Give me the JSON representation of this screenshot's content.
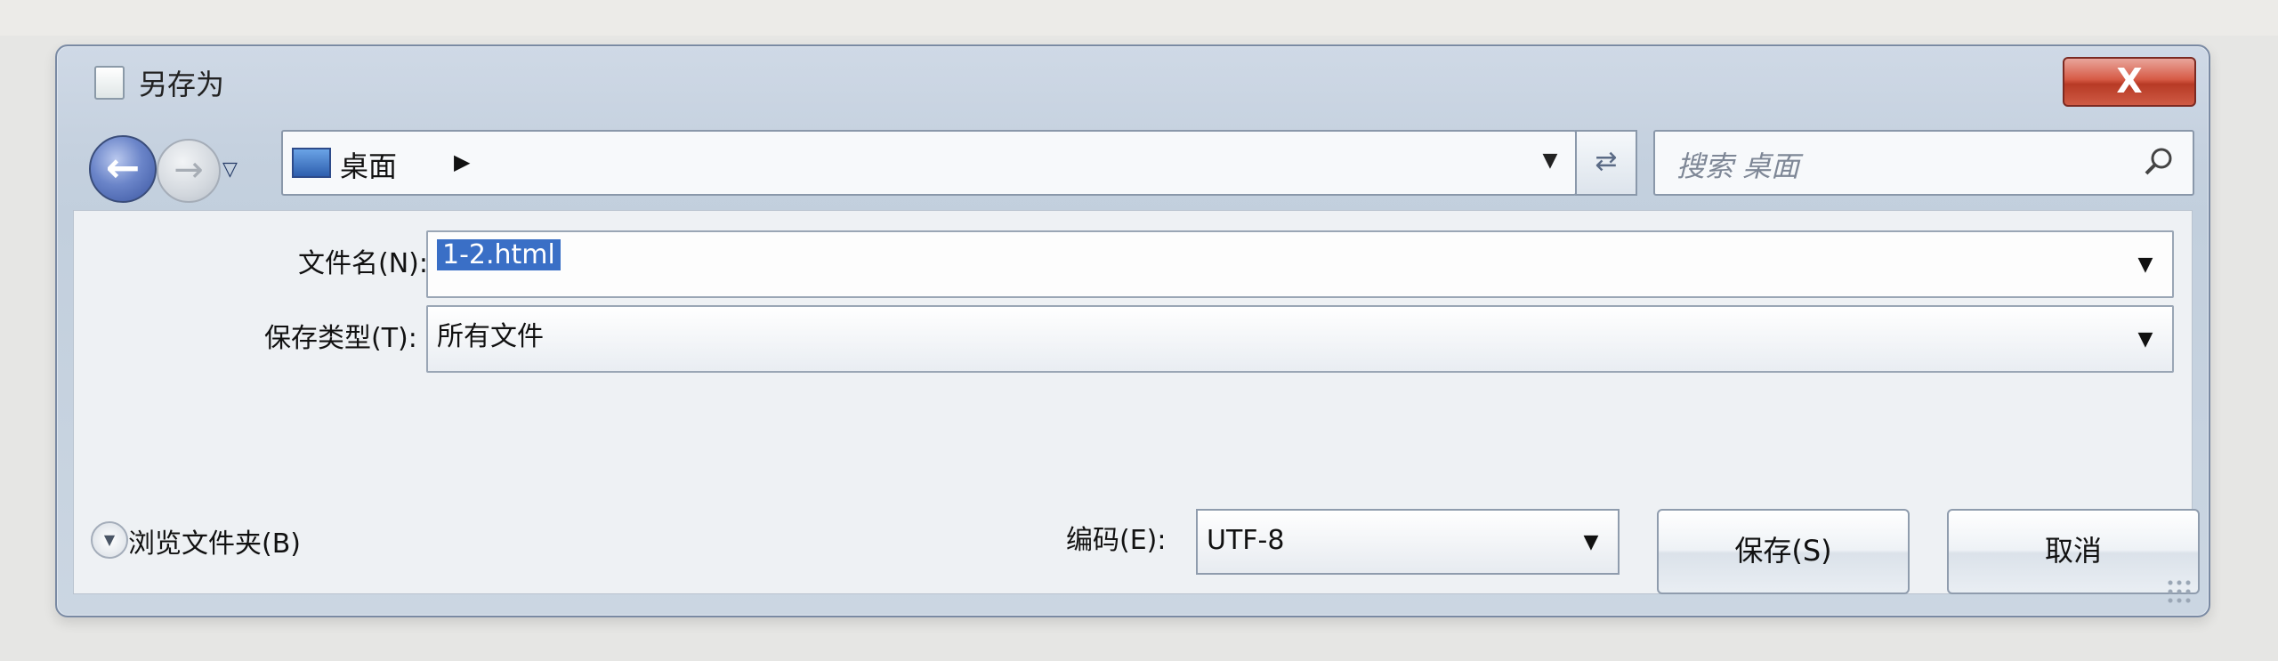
{
  "dialog": {
    "title": "另存为",
    "close_label": "X"
  },
  "nav": {
    "location": "桌面",
    "search_placeholder": "搜索 桌面"
  },
  "form": {
    "filename_label": "文件名(N):",
    "filename_value": "1-2.html",
    "filetype_label": "保存类型(T):",
    "filetype_value": "所有文件",
    "encoding_label": "编码(E):",
    "encoding_value": "UTF-8"
  },
  "footer": {
    "browse_label": "浏览文件夹(B)",
    "save_label": "保存(S)",
    "cancel_label": "取消"
  },
  "icons": {
    "back": "arrow-left-icon",
    "forward": "arrow-right-icon",
    "history_dropdown": "chevron-down-icon",
    "location": "desktop-icon",
    "breadcrumb_separator": "chevron-right-icon",
    "refresh": "refresh-icon",
    "search": "search-icon",
    "browse_toggle": "chevron-down-icon"
  }
}
